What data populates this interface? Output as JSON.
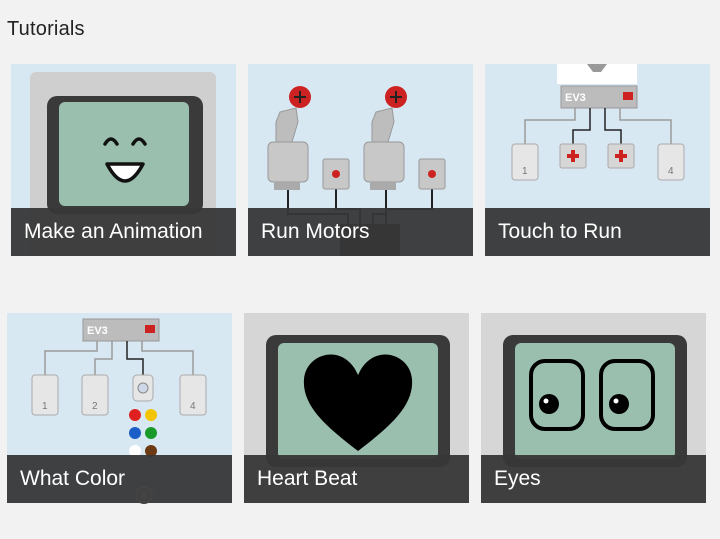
{
  "page": {
    "title": "Tutorials"
  },
  "colors": {
    "caption_bg": "#373737",
    "screen": "#9bbfae",
    "frame": "#3a3a3a",
    "panel_bg": "#d8e8f2",
    "port_red": "#cc2222"
  },
  "cards": [
    {
      "label": "Make an Animation",
      "icon": "smiley-face-screen"
    },
    {
      "label": "Run Motors",
      "icon": "motors-diagram"
    },
    {
      "label": "Touch to Run",
      "icon": "touch-sensors-diagram"
    },
    {
      "label": "What Color",
      "icon": "color-sensor-diagram"
    },
    {
      "label": "Heart Beat",
      "icon": "heart-screen"
    },
    {
      "label": "Eyes",
      "icon": "eyes-screen"
    }
  ],
  "ev3": {
    "brick_label": "EV3",
    "ports": [
      "1",
      "2",
      "4"
    ]
  }
}
